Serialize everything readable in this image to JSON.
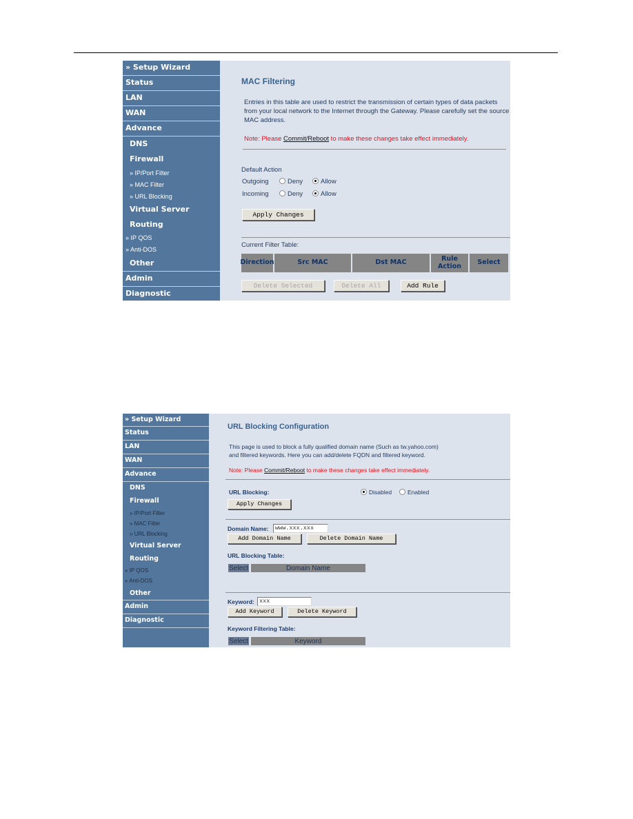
{
  "sidebar": {
    "top_items": [
      "» Setup Wizard",
      "Status",
      "LAN",
      "WAN",
      "Advance"
    ],
    "sub_items": [
      "DNS",
      "Firewall"
    ],
    "firewall_children": [
      "» IP/Port Filter",
      "» MAC Filter",
      "» URL Blocking"
    ],
    "sub_items_2": [
      "Virtual Server",
      "Routing"
    ],
    "advance_children": [
      "» IP QOS",
      "» Anti-DOS"
    ],
    "other": "Other",
    "bottom_items": [
      "Admin",
      "Diagnostic"
    ]
  },
  "mac_filtering": {
    "title": "MAC Filtering",
    "description": "Entries in this table are used to restrict the transmission of certain types of data packets from your local network to the Internet through the Gateway. Please carefully set the source MAC address.",
    "note_prefix": "Note: Please ",
    "note_link": "Commit/Reboot",
    "note_suffix": " to make these changes take effect immediately.",
    "default_action_label": "Default Action",
    "outgoing_label": "Outgoing",
    "incoming_label": "Incoming",
    "deny_label": "Deny",
    "allow_label": "Allow",
    "outgoing_value": "Allow",
    "incoming_value": "Allow",
    "apply_button": "Apply Changes",
    "table_label": "Current Filter Table:",
    "table_headers": [
      "Direction",
      "Src MAC",
      "Dst MAC",
      "Rule Action",
      "Select"
    ],
    "table_rows": [],
    "delete_selected_button": "Delete Selected",
    "delete_all_button": "Delete All",
    "add_rule_button": "Add Rule"
  },
  "url_blocking": {
    "title": "URL Blocking Configuration",
    "description_line1": "This page is used to block a fully qualified domain name (Such as tw.yahoo.com)",
    "description_line2": "and filtered keywords. Here you can add/delete FQDN and filtered keyword.",
    "note_prefix": "Note: Please ",
    "note_link": "Commit/Reboot",
    "note_suffix": " to make these changes take effect immediately.",
    "url_blocking_label": "URL Blocking:",
    "disabled_label": "Disabled",
    "enabled_label": "Enabled",
    "url_blocking_value": "Disabled",
    "apply_button": "Apply Changes",
    "domain_name_label": "Domain Name:",
    "domain_name_value": "www.xxx.xxx",
    "add_domain_button": "Add Domain Name",
    "delete_domain_button": "Delete Domain Name",
    "url_table_label": "URL Blocking Table:",
    "url_table_headers": [
      "Select",
      "Domain Name"
    ],
    "keyword_label": "Keyword:",
    "keyword_value": "xxx",
    "add_keyword_button": "Add Keyword",
    "delete_keyword_button": "Delete Keyword",
    "keyword_table_label": "Keyword Filtering Table:",
    "keyword_table_headers": [
      "Select",
      "Keyword"
    ]
  }
}
